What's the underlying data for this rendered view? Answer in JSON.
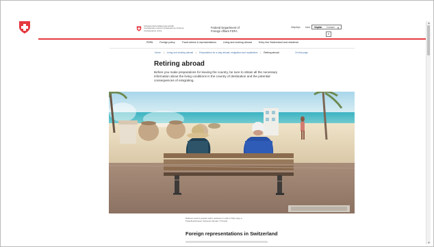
{
  "header": {
    "federal_small_text": "Schweizerische Eidgenossenschaft Confédération suisse Confederazione Svizzera Confederaziun svizra",
    "department_name": "Federal Department of Foreign Affairs FDFA",
    "util_links": [
      "Help/tips",
      "Jobs",
      "Media",
      "Contact"
    ],
    "language": "English",
    "search_icon": "search-icon"
  },
  "nav": {
    "items": [
      "FDFA",
      "Foreign policy",
      "Travel advice & representations",
      "Living and working abroad",
      "Entry into Switzerland and residence"
    ]
  },
  "breadcrumb": {
    "items": [
      "Home",
      "Living and working abroad",
      "Preparations for a stay abroad, emigration and repatriation",
      "Retiring abroad"
    ],
    "on_this_page": "On this page"
  },
  "main": {
    "title": "Retiring abroad",
    "lead": "Before you make preparations for leaving the country, be sure to obtain all the necessary information about the living conditions in the country of destination and the potential consequences of emigrating.",
    "caption": "Retirees need to prepare well in advance in order to fully enjoy a Predefined/unseen retirement abroad. © Pexels",
    "section_title": "Foreign representations in Switzerland"
  },
  "colors": {
    "accent_red": "#e53940",
    "link_blue": "#3f6fa8"
  }
}
